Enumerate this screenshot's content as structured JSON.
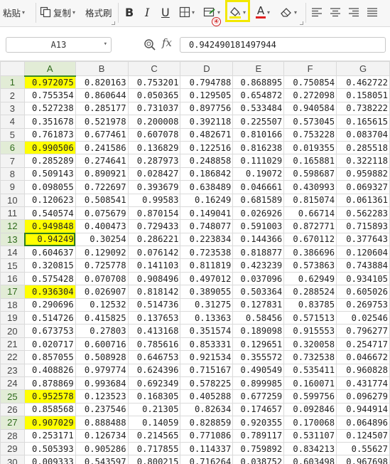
{
  "toolbar": {
    "paste_label": "粘贴",
    "copy_label": "复制",
    "format_painter_label": "格式刷",
    "bold_label": "B",
    "italic_label": "I",
    "underline_label": "U",
    "font_color_label": "A",
    "step_badge": "④",
    "fill_color": "#f5ed00",
    "font_color": "#e02020"
  },
  "formula_bar": {
    "name_box": "A13",
    "fx_label": "fx",
    "formula_value": "0.942490181497944"
  },
  "sheet": {
    "columns": [
      "A",
      "B",
      "C",
      "D",
      "E",
      "F",
      "G"
    ],
    "selected_column": "A",
    "active_row": 13,
    "highlighted_rows": [
      1,
      6,
      12,
      13,
      17,
      25,
      27
    ],
    "highlight_color": "#ffff00",
    "rows": [
      {
        "n": "1",
        "cells": [
          "0.972075",
          "0.820163",
          "0.753201",
          "0.794788",
          "0.868895",
          "0.750854",
          "0.462722"
        ]
      },
      {
        "n": "2",
        "cells": [
          "0.755354",
          "0.860644",
          "0.050365",
          "0.129505",
          "0.654872",
          "0.272098",
          "0.158051"
        ]
      },
      {
        "n": "3",
        "cells": [
          "0.527238",
          "0.285177",
          "0.731037",
          "0.897756",
          "0.533484",
          "0.940584",
          "0.738222"
        ]
      },
      {
        "n": "4",
        "cells": [
          "0.351678",
          "0.521978",
          "0.200008",
          "0.392118",
          "0.225507",
          "0.573045",
          "0.165615"
        ]
      },
      {
        "n": "5",
        "cells": [
          "0.761873",
          "0.677461",
          "0.607078",
          "0.482671",
          "0.810166",
          "0.753228",
          "0.083704"
        ]
      },
      {
        "n": "6",
        "cells": [
          "0.990506",
          "0.241586",
          "0.136829",
          "0.122516",
          "0.816238",
          "0.019355",
          "0.285518"
        ]
      },
      {
        "n": "7",
        "cells": [
          "0.285289",
          "0.274641",
          "0.287973",
          "0.248858",
          "0.111029",
          "0.165881",
          "0.322118"
        ]
      },
      {
        "n": "8",
        "cells": [
          "0.509143",
          "0.890921",
          "0.028427",
          "0.186842",
          "0.19072",
          "0.598687",
          "0.959882"
        ]
      },
      {
        "n": "9",
        "cells": [
          "0.098055",
          "0.722697",
          "0.393679",
          "0.638489",
          "0.046661",
          "0.430993",
          "0.069327"
        ]
      },
      {
        "n": "10",
        "cells": [
          "0.120623",
          "0.508541",
          "0.99583",
          "0.16249",
          "0.681589",
          "0.815074",
          "0.061361"
        ]
      },
      {
        "n": "11",
        "cells": [
          "0.540574",
          "0.075679",
          "0.870154",
          "0.149041",
          "0.026926",
          "0.66714",
          "0.562283"
        ]
      },
      {
        "n": "12",
        "cells": [
          "0.949848",
          "0.400473",
          "0.729433",
          "0.748077",
          "0.591003",
          "0.872771",
          "0.715893"
        ]
      },
      {
        "n": "13",
        "cells": [
          "0.94249",
          "0.30254",
          "0.286221",
          "0.223834",
          "0.144366",
          "0.670112",
          "0.377643"
        ]
      },
      {
        "n": "14",
        "cells": [
          "0.604637",
          "0.129092",
          "0.076142",
          "0.723538",
          "0.818877",
          "0.386696",
          "0.120604"
        ]
      },
      {
        "n": "15",
        "cells": [
          "0.320815",
          "0.725778",
          "0.141103",
          "0.811819",
          "0.423239",
          "0.573863",
          "0.743884"
        ]
      },
      {
        "n": "16",
        "cells": [
          "0.575428",
          "0.070708",
          "0.908496",
          "0.497012",
          "0.037096",
          "0.62949",
          "0.934105"
        ]
      },
      {
        "n": "17",
        "cells": [
          "0.936304",
          "0.026907",
          "0.818142",
          "0.389055",
          "0.503364",
          "0.288524",
          "0.605026"
        ]
      },
      {
        "n": "18",
        "cells": [
          "0.290696",
          "0.12532",
          "0.514736",
          "0.31275",
          "0.127831",
          "0.83785",
          "0.269753"
        ]
      },
      {
        "n": "19",
        "cells": [
          "0.514726",
          "0.415825",
          "0.137653",
          "0.13363",
          "0.58456",
          "0.571513",
          "0.02546"
        ]
      },
      {
        "n": "20",
        "cells": [
          "0.673753",
          "0.27803",
          "0.413168",
          "0.351574",
          "0.189098",
          "0.915553",
          "0.796277"
        ]
      },
      {
        "n": "21",
        "cells": [
          "0.020717",
          "0.600716",
          "0.785616",
          "0.853331",
          "0.129651",
          "0.320058",
          "0.254717"
        ]
      },
      {
        "n": "22",
        "cells": [
          "0.857055",
          "0.508928",
          "0.646753",
          "0.921534",
          "0.355572",
          "0.732538",
          "0.046672"
        ]
      },
      {
        "n": "23",
        "cells": [
          "0.408826",
          "0.979774",
          "0.624396",
          "0.715167",
          "0.490549",
          "0.535411",
          "0.960828"
        ]
      },
      {
        "n": "24",
        "cells": [
          "0.878869",
          "0.993684",
          "0.692349",
          "0.578225",
          "0.899985",
          "0.160071",
          "0.431774"
        ]
      },
      {
        "n": "25",
        "cells": [
          "0.952578",
          "0.123523",
          "0.168305",
          "0.405288",
          "0.677259",
          "0.599756",
          "0.096279"
        ]
      },
      {
        "n": "26",
        "cells": [
          "0.858568",
          "0.237546",
          "0.21305",
          "0.82634",
          "0.174657",
          "0.092846",
          "0.944914"
        ]
      },
      {
        "n": "27",
        "cells": [
          "0.907029",
          "0.888488",
          "0.14059",
          "0.828859",
          "0.920355",
          "0.170068",
          "0.064896"
        ]
      },
      {
        "n": "28",
        "cells": [
          "0.253171",
          "0.126734",
          "0.214565",
          "0.771086",
          "0.789117",
          "0.531107",
          "0.124507"
        ]
      },
      {
        "n": "29",
        "cells": [
          "0.505393",
          "0.905286",
          "0.717855",
          "0.114337",
          "0.759892",
          "0.834213",
          "0.55627"
        ]
      },
      {
        "n": "30",
        "cells": [
          "0.009333",
          "0.543597",
          "0.800215",
          "0.716264",
          "0.038752",
          "0.603498",
          "0.967698"
        ]
      }
    ]
  }
}
